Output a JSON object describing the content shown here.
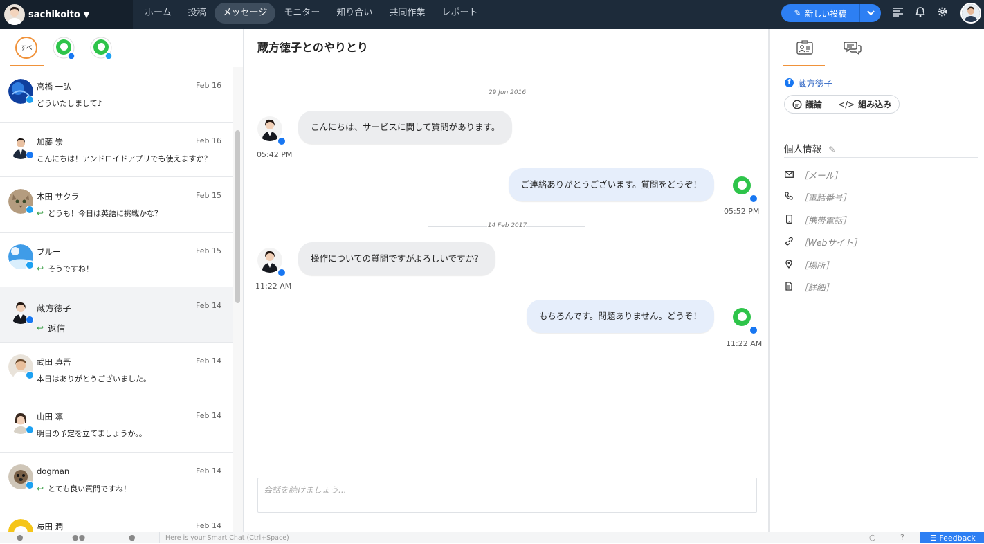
{
  "header": {
    "username": "sachikoito",
    "nav": [
      "ホーム",
      "投稿",
      "メッセージ",
      "モニター",
      "知り合い",
      "共同作業",
      "レポート"
    ],
    "active_nav": 2,
    "new_post_label": "新しい投稿",
    "icons": [
      "menu-icon",
      "bell-icon",
      "gear-icon"
    ]
  },
  "filters": {
    "all_label": "すべ",
    "sources": [
      "messenger-facebook",
      "messenger-twitter"
    ]
  },
  "conversations": [
    {
      "name": "高橋 一弘",
      "date": "Feb 16",
      "message": "どういたしまして♪",
      "source": "twitter",
      "reply": false,
      "avatar": "globe"
    },
    {
      "name": "加藤 崇",
      "date": "Feb 16",
      "message": "こんにちは！アンドロイドアプリでも使えますか？",
      "source": "facebook",
      "reply": false,
      "avatar": "man"
    },
    {
      "name": "木田 サクラ",
      "date": "Feb 15",
      "message": "どうも！今日は英語に挑戦かな？",
      "source": "twitter",
      "reply": true,
      "avatar": "cat"
    },
    {
      "name": "ブルー",
      "date": "Feb 15",
      "message": "そうですね！",
      "source": "twitter",
      "reply": true,
      "avatar": "sky"
    },
    {
      "name": "蔵方徳子",
      "date": "Feb 14",
      "message": "返信",
      "source": "facebook",
      "reply": true,
      "avatar": "woman",
      "selected": true
    },
    {
      "name": "武田 真吾",
      "date": "Feb 14",
      "message": "本日はありがとうございました。",
      "source": "twitter",
      "reply": false,
      "avatar": "man2"
    },
    {
      "name": "山田 凛",
      "date": "Feb 14",
      "message": "明日の予定を立てましょうか。。",
      "source": "twitter",
      "reply": false,
      "avatar": "woman2"
    },
    {
      "name": "dogman",
      "date": "Feb 14",
      "message": "とても良い質問ですね！",
      "source": "twitter",
      "reply": true,
      "avatar": "dog"
    },
    {
      "name": "与田 潤",
      "date": "Feb 14",
      "message": "",
      "source": "twitter",
      "reply": false,
      "avatar": "yellow"
    }
  ],
  "thread": {
    "title": "蔵方徳子とのやりとり",
    "dates": [
      "29 Jun 2016",
      "14 Feb 2017"
    ],
    "messages": [
      {
        "text": "こんにちは、サービスに関して質問があります。",
        "time": "05:42 PM",
        "direction": "in"
      },
      {
        "text": "ご連絡ありがとうございます。質問をどうぞ！",
        "time": "05:52 PM",
        "direction": "out"
      },
      {
        "text": "操作についての質問ですがよろしいですか？",
        "time": "11:22 AM",
        "direction": "in"
      },
      {
        "text": "もちろんです。問題ありません。どうぞ！",
        "time": "11:22 AM",
        "direction": "out"
      }
    ],
    "composer_placeholder": "会話を続けましょう..."
  },
  "contact": {
    "name": "蔵方徳子",
    "buttons": [
      "議論",
      "組み込み"
    ],
    "section_title": "個人情報",
    "fields": [
      {
        "icon": "mail-icon",
        "label": "［メール］"
      },
      {
        "icon": "phone-icon",
        "label": "［電話番号］"
      },
      {
        "icon": "mobile-icon",
        "label": "［携帯電話］"
      },
      {
        "icon": "link-icon",
        "label": "［Webサイト］"
      },
      {
        "icon": "location-icon",
        "label": "［場所］"
      },
      {
        "icon": "document-icon",
        "label": "［詳細］"
      }
    ]
  },
  "bottom": {
    "smartchat_placeholder": "Here is your Smart Chat (Ctrl+Space)",
    "feedback_label": "Feedback"
  },
  "colors": {
    "topbar": "#1d2b3a",
    "accent_orange": "#f0923a",
    "primary_blue": "#2d7ff3",
    "facebook": "#1877f2",
    "twitter": "#1da1f2",
    "reply_green": "#3fa14a",
    "messenger_green": "#2ec44a"
  }
}
